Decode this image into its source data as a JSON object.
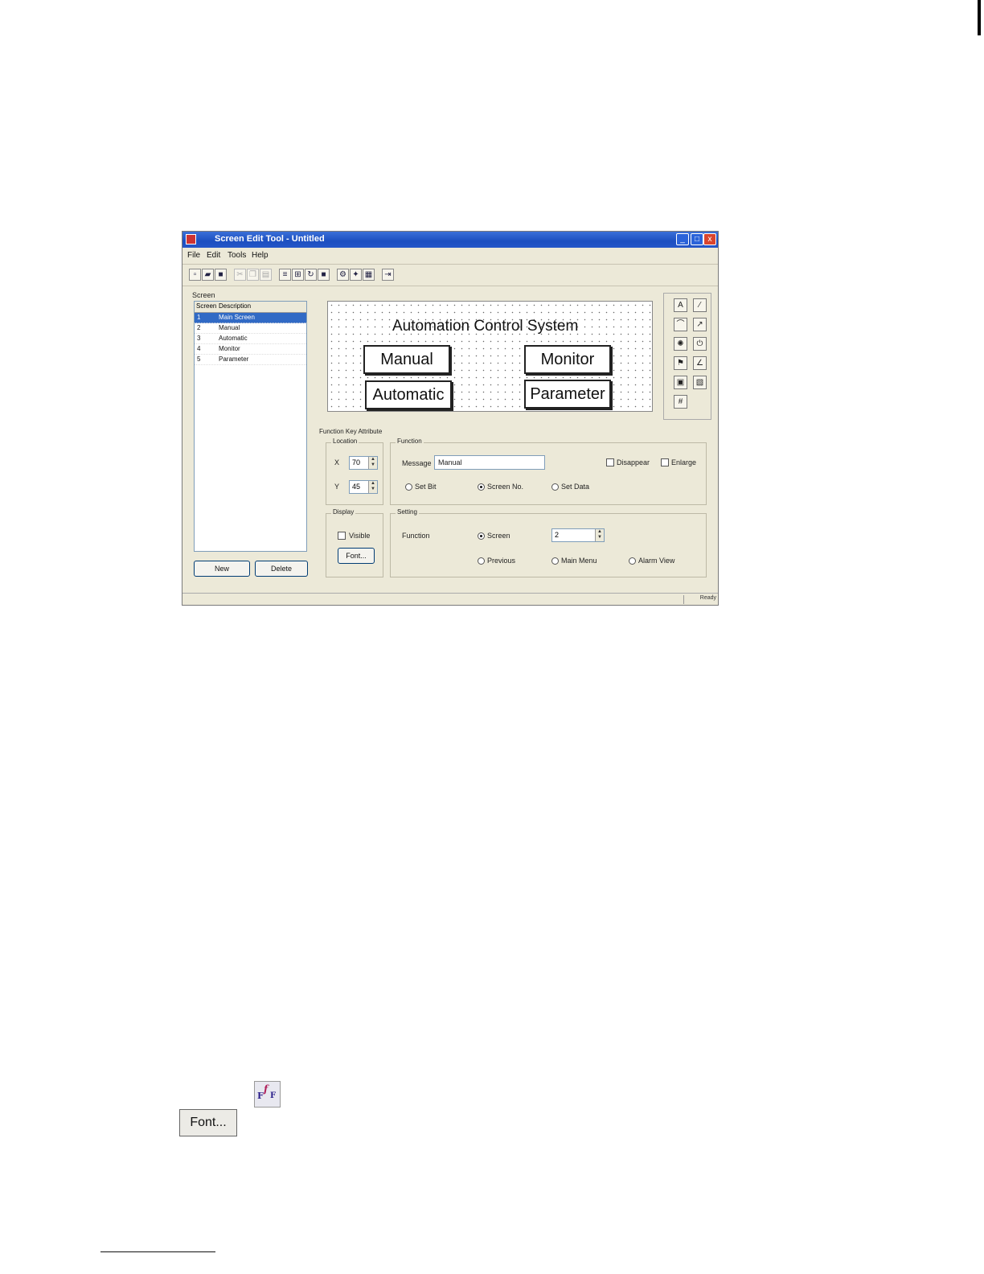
{
  "window": {
    "title": "Screen Edit Tool - Untitled",
    "controls": {
      "minimize": "_",
      "maximize": "□",
      "close": "x"
    }
  },
  "menu": [
    "File",
    "Edit",
    "Tools",
    "Help"
  ],
  "toolbar": {
    "icons": [
      "new-icon",
      "open-icon",
      "save-icon",
      "cut-icon",
      "copy-icon",
      "paste-icon",
      "align-icon",
      "group-icon",
      "rotate-icon",
      "stop-icon",
      "properties-icon",
      "settings-icon",
      "grid-icon",
      "exit-icon"
    ]
  },
  "screen_list": {
    "group_label": "Screen",
    "headers": [
      "Screen",
      "Description"
    ],
    "rows": [
      {
        "no": "1",
        "name": "Main Screen",
        "selected": true
      },
      {
        "no": "2",
        "name": "Manual"
      },
      {
        "no": "3",
        "name": "Automatic"
      },
      {
        "no": "4",
        "name": "Monitor"
      },
      {
        "no": "5",
        "name": "Parameter"
      }
    ],
    "new_label": "New",
    "delete_label": "Delete"
  },
  "canvas": {
    "title": "Automation Control System",
    "buttons": [
      "Manual",
      "Monitor",
      "Automatic",
      "Parameter"
    ]
  },
  "palette": {
    "icons": [
      "text-icon",
      "line-icon",
      "arc-icon",
      "arrow-icon",
      "lamp-icon",
      "switch-icon",
      "flag-icon",
      "chart-icon",
      "button-icon",
      "bitmap-icon",
      "numeric-icon"
    ]
  },
  "properties": {
    "title": "Function Key Attribute",
    "location": {
      "legend": "Location",
      "x_label": "X",
      "x_value": "70",
      "y_label": "Y",
      "y_value": "45"
    },
    "function": {
      "legend": "Function",
      "message_label": "Message",
      "message_value": "Manual",
      "check_1": "Disappear",
      "check_2": "Enlarge",
      "radio_1": "Set Bit",
      "radio_2": "Screen No.",
      "radio_3": "Set Data"
    },
    "display": {
      "legend": "Display",
      "check_label": "Visible",
      "button_label": "Font..."
    },
    "setting": {
      "legend": "Setting",
      "label": "Function",
      "radio_screen": "Screen",
      "spin_value": "2",
      "radio_previous": "Previous",
      "radio_main": "Main Menu",
      "radio_alarm": "Alarm View"
    }
  },
  "status": {
    "right_text": "Ready"
  },
  "footer": {
    "icon_name": "font-icon",
    "ff_glyph_1": "F",
    "ff_glyph_2": "f",
    "ff_glyph_3": "F",
    "font_button": "Font..."
  }
}
